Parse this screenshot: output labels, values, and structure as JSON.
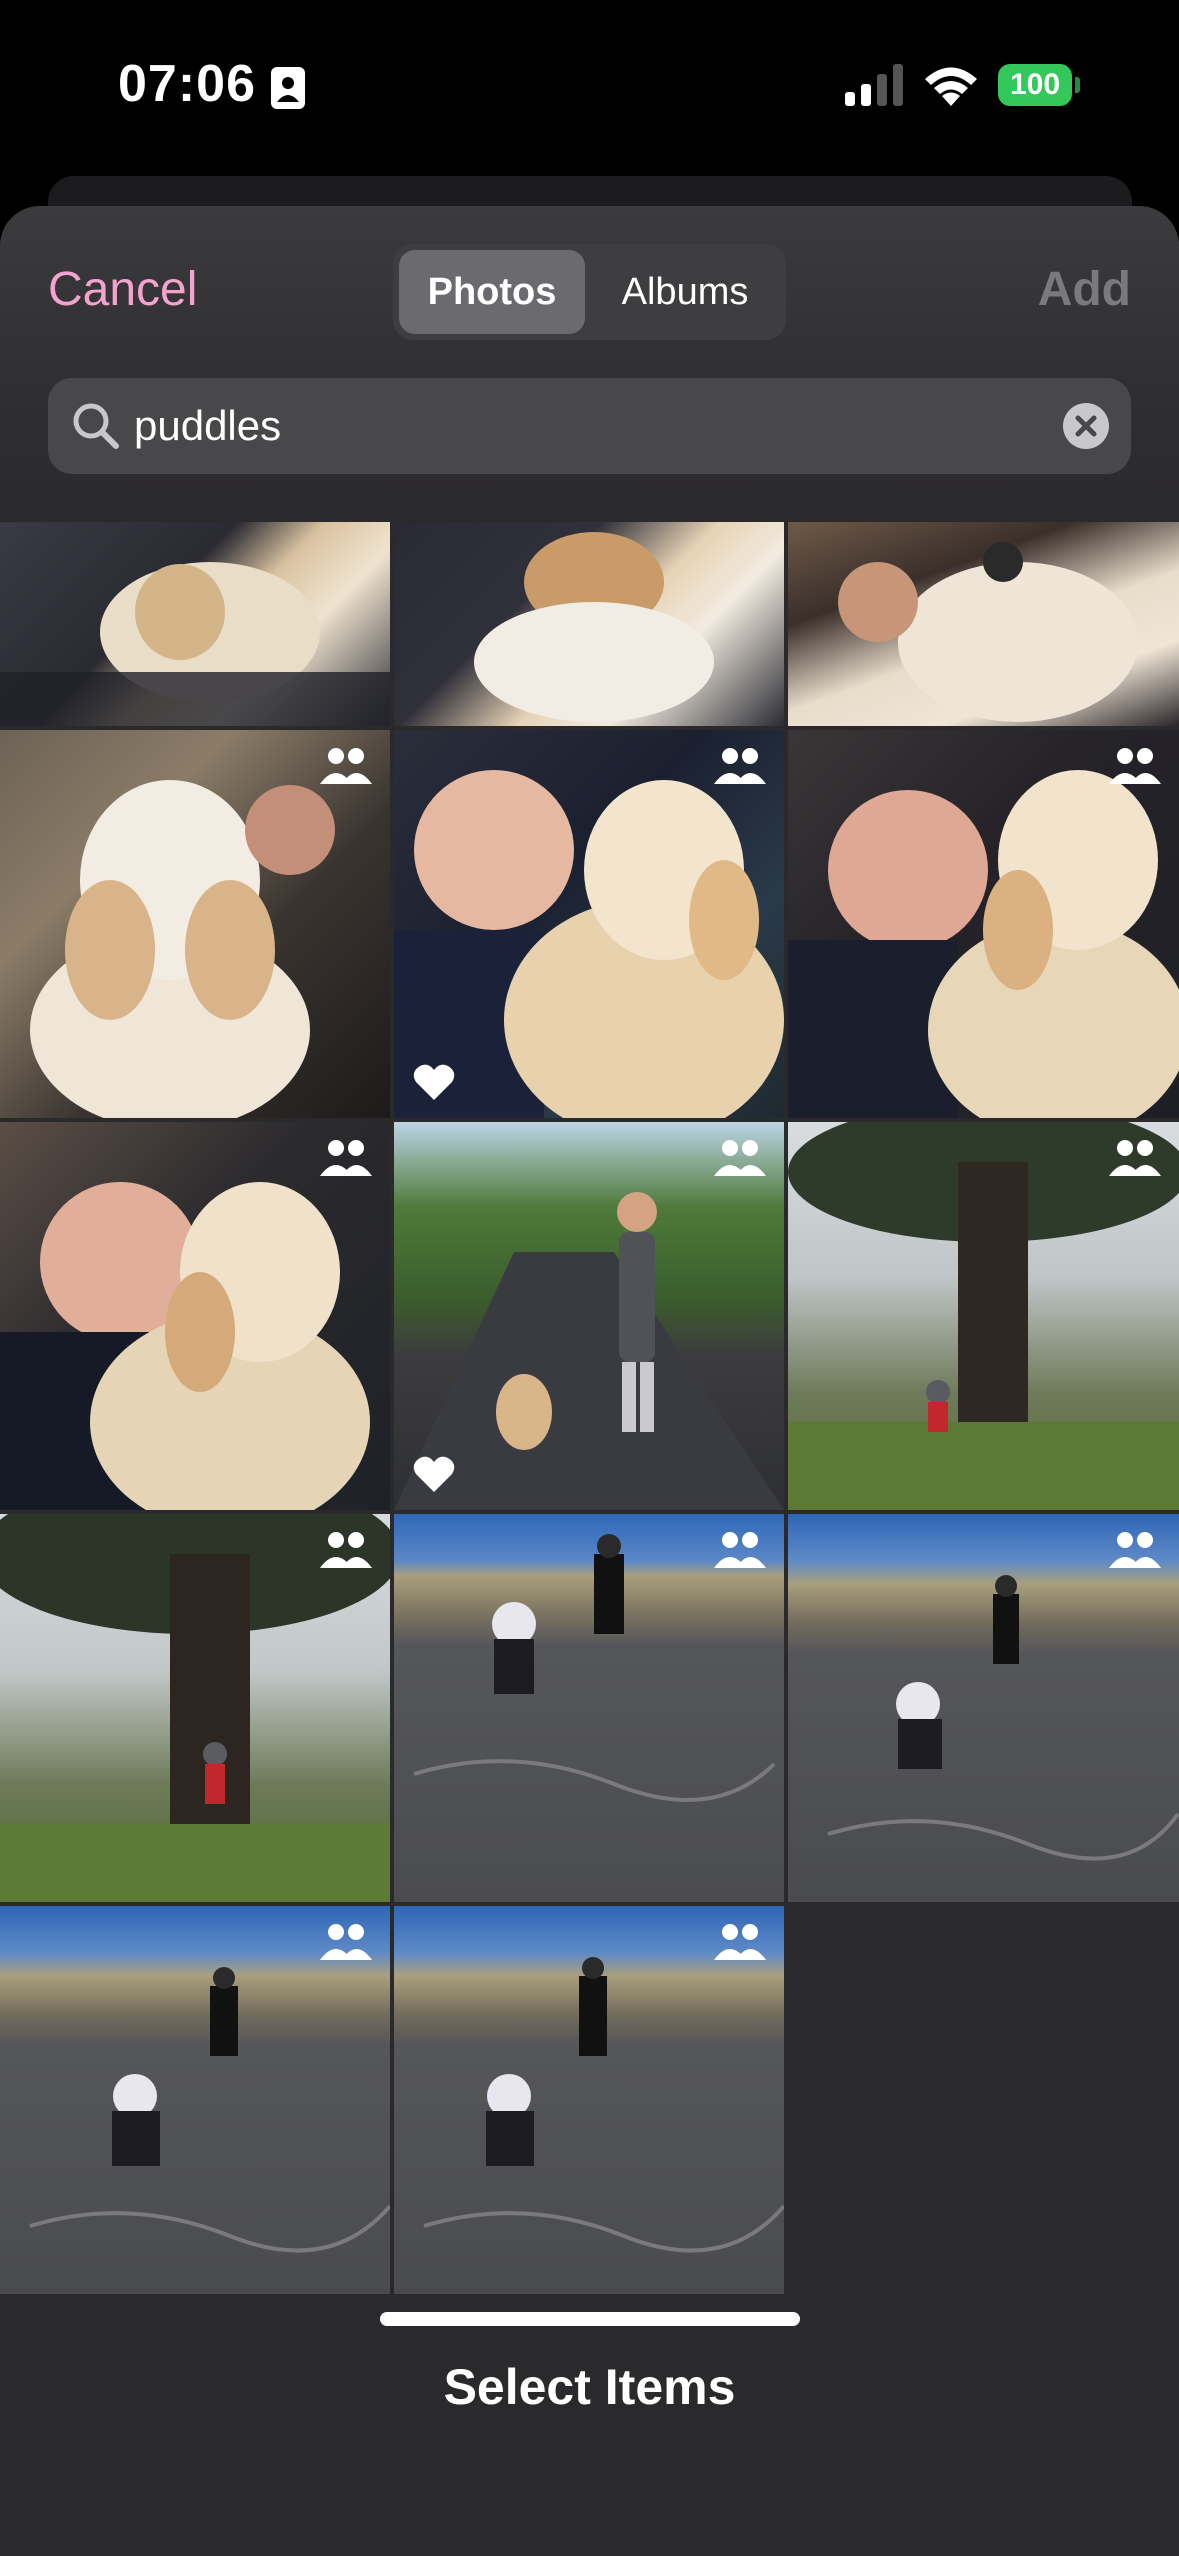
{
  "status": {
    "time": "07:06",
    "battery": "100"
  },
  "header": {
    "cancel": "Cancel",
    "segments": [
      "Photos",
      "Albums"
    ],
    "active_segment": "Photos",
    "add": "Add",
    "search": {
      "value": "puddles"
    }
  },
  "colors": {
    "accent": "#f4a3cf",
    "battery": "#34c759",
    "disabled": "#7a797c"
  },
  "grid": {
    "items": [
      {
        "scene": "dog-in-lap-1",
        "people": false,
        "favorite": false
      },
      {
        "scene": "dog-in-lap-2",
        "people": false,
        "favorite": false
      },
      {
        "scene": "dog-closeup",
        "people": false,
        "favorite": false
      },
      {
        "scene": "poodle-on-couch",
        "people": true,
        "favorite": false
      },
      {
        "scene": "girl-with-poodle",
        "people": true,
        "favorite": true
      },
      {
        "scene": "girl-with-poodle-car",
        "people": true,
        "favorite": false
      },
      {
        "scene": "girl-with-poodle-car-2",
        "people": true,
        "favorite": false
      },
      {
        "scene": "walk-on-road",
        "people": true,
        "favorite": true
      },
      {
        "scene": "big-tree-1",
        "people": true,
        "favorite": false
      },
      {
        "scene": "big-tree-2",
        "people": true,
        "favorite": false
      },
      {
        "scene": "beach-drawing-1",
        "people": true,
        "favorite": false
      },
      {
        "scene": "beach-drawing-2",
        "people": true,
        "favorite": false
      },
      {
        "scene": "beach-drawing-3",
        "people": true,
        "favorite": false
      },
      {
        "scene": "beach-drawing-4",
        "people": true,
        "favorite": false
      }
    ]
  },
  "footer": {
    "title": "Select Items"
  }
}
